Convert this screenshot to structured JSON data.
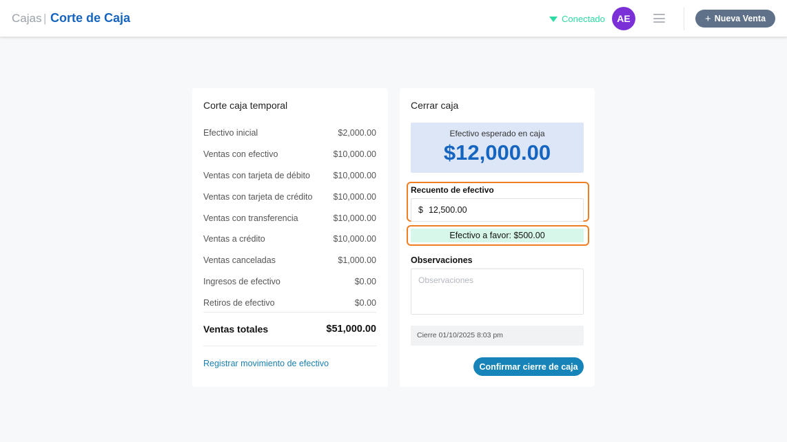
{
  "header": {
    "breadcrumb_parent": "Cajas",
    "breadcrumb_separator": "|",
    "breadcrumb_current": "Corte de Caja",
    "status_label": "Conectado",
    "status_icon": "wifi-icon",
    "avatar_initials": "AE",
    "menu_icon": "hamburger-icon",
    "new_sale_icon": "+",
    "new_sale_label": "Nueva Venta"
  },
  "summary": {
    "title": "Corte caja temporal",
    "rows": [
      {
        "label": "Efectivo inicial",
        "value": "$2,000.00"
      },
      {
        "label": "Ventas con efectivo",
        "value": "$10,000.00"
      },
      {
        "label": "Ventas con tarjeta de débito",
        "value": "$10,000.00"
      },
      {
        "label": "Ventas con tarjeta de crédito",
        "value": "$10,000.00"
      },
      {
        "label": "Ventas con transferencia",
        "value": "$10,000.00"
      },
      {
        "label": "Ventas a crédito",
        "value": "$10,000.00"
      },
      {
        "label": "Ventas canceladas",
        "value": "$1,000.00"
      },
      {
        "label": "Ingresos de efectivo",
        "value": "$0.00"
      },
      {
        "label": "Retiros de efectivo",
        "value": "$0.00"
      }
    ],
    "total_label": "Ventas totales",
    "total_value": "$51,000.00",
    "link_label": "Registrar movimiento de efectivo"
  },
  "close": {
    "title": "Cerrar caja",
    "expected_label": "Efectivo esperado en caja",
    "expected_amount": "$12,000.00",
    "count_label": "Recuento de efectivo",
    "currency_symbol": "$",
    "count_value": "12,500.00",
    "favor_text": "Efectivo a favor: $500.00",
    "observations_label": "Observaciones",
    "observations_placeholder": "Observaciones",
    "close_info": "Cierre 01/10/2025 8:03 pm",
    "confirm_label": "Confirmar cierre de caja"
  },
  "colors": {
    "accent_blue": "#1565c0",
    "status_green": "#2fd9a3",
    "avatar_purple": "#7b2fd6",
    "highlight_orange": "#ef7d22",
    "confirm_button": "#1684b9"
  }
}
